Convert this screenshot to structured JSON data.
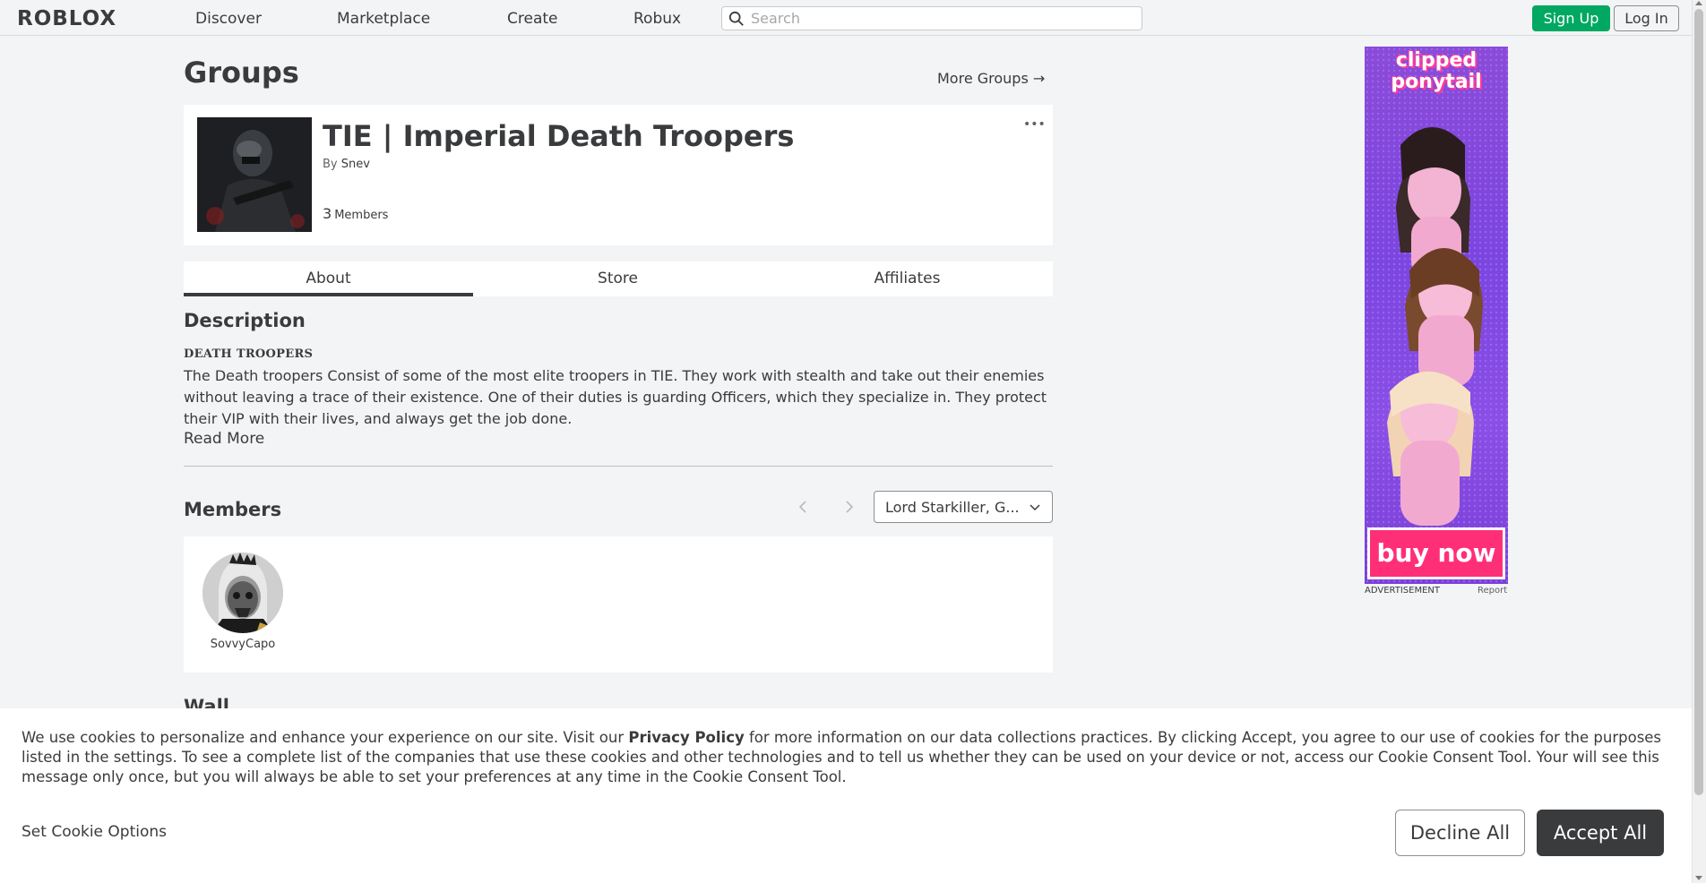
{
  "nav": {
    "logo": "ROBLOX",
    "links": [
      "Discover",
      "Marketplace",
      "Create",
      "Robux"
    ],
    "search_placeholder": "Search",
    "signup_label": "Sign Up",
    "login_label": "Log In"
  },
  "page": {
    "title": "Groups",
    "more_groups": "More Groups →"
  },
  "group": {
    "name": "TIE | Imperial Death Troopers",
    "by_prefix": "By",
    "owner": "Snev",
    "member_count": "3",
    "member_label": "Members",
    "more_icon": "•••"
  },
  "tabs": [
    "About",
    "Store",
    "Affiliates"
  ],
  "about": {
    "description_heading": "Description",
    "desc_title": "DEATH TROOPERS",
    "desc_body": "The Death troopers Consist of some of the most elite troopers in TIE. They work with stealth and take out their enemies without leaving a trace of their existence. One of their duties is guarding Officers, which they specialize in. They protect their VIP with their lives, and always get the job done.",
    "read_more": "Read More"
  },
  "members": {
    "heading": "Members",
    "role_selected": "Lord Starkiller, G...",
    "list": [
      {
        "name": "SovvyCapo"
      }
    ]
  },
  "wall": {
    "heading": "Wall"
  },
  "ad": {
    "title": "clipped ponytail",
    "cta": "buy now",
    "label": "ADVERTISEMENT",
    "report": "Report"
  },
  "cookie": {
    "text_1": "We use cookies to personalize and enhance your experience on our site. Visit our ",
    "policy_link": "Privacy Policy",
    "text_2": " for more information on our data collections practices. By clicking Accept, you agree to our use of cookies for the purposes listed in the settings. To see a complete list of the companies that use these cookies and other technologies and to tell us whether they can be used on your device or not, access our Cookie Consent Tool. Your will see this message only once, but you will always be able to set your preferences at any time in the Cookie Consent Tool.",
    "set_options": "Set Cookie Options",
    "decline": "Decline All",
    "accept": "Accept All"
  },
  "colors": {
    "accent_green": "#00a862",
    "text": "#393b3d",
    "background": "#f2f4f5",
    "ad_pink": "#ff2f77",
    "ad_purple": "#8b4bd8"
  }
}
